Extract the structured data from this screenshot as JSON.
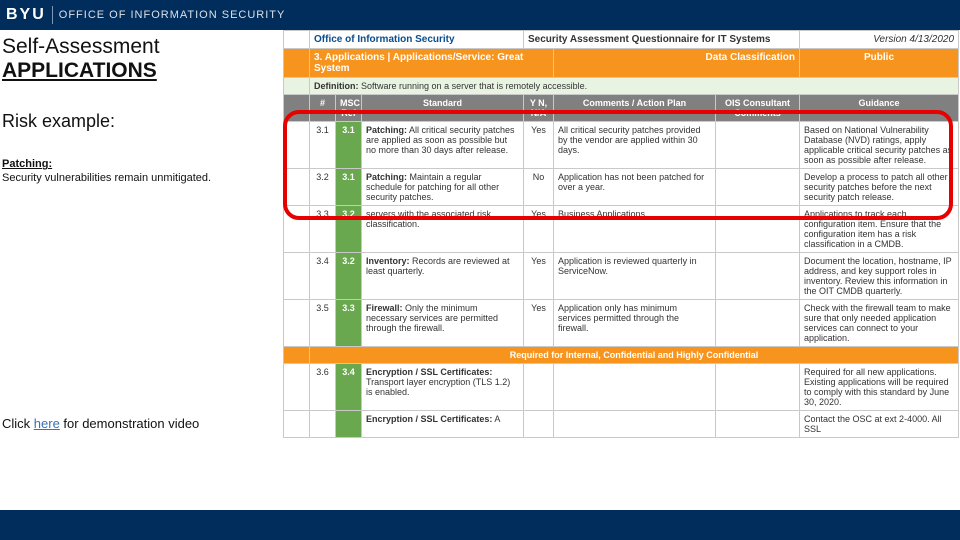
{
  "banner": {
    "logo": "BYU",
    "office": "OFFICE OF INFORMATION SECURITY"
  },
  "left": {
    "title_line1": "Self-Assessment",
    "title_line2": "APPLICATIONS",
    "risk_heading": "Risk example:",
    "patch_label": "Patching:",
    "patch_text": "Security vulnerabilities remain unmitigated.",
    "demo_pre": "Click ",
    "demo_link": "here",
    "demo_post": " for demonstration video"
  },
  "sheet": {
    "top": {
      "office": "Office of Information Security",
      "questionnaire": "Security Assessment Questionnaire for IT Systems",
      "version": "Version 4/13/2020"
    },
    "subheader": {
      "section": "3. Applications  |  Applications/Service: Great System",
      "dc_label": "Data Classification",
      "dc_value": "Public"
    },
    "definition_label": "Definition:",
    "definition_text": "Software running on a server that is remotely accessible.",
    "columns": [
      "#",
      "MSC Ref",
      "Standard",
      "Y N, N/A",
      "Comments / Action Plan",
      "OIS Consultant Comments",
      "Guidance"
    ],
    "rows": [
      {
        "num": "3.1",
        "msc": "3.1",
        "std_label": "Patching:",
        "std_text": "All critical security patches are applied as soon as possible but no more than 30 days after release.",
        "yn": "Yes",
        "comment": "All critical security patches provided by the vendor are applied within 30 days.",
        "guidance": "Based on National Vulnerability Database (NVD) ratings, apply applicable critical security patches as soon as possible after release."
      },
      {
        "num": "3.2",
        "msc": "3.1",
        "std_label": "Patching:",
        "std_text": "Maintain a regular schedule for patching for all other security patches.",
        "yn": "No",
        "comment": "Application has not been patched for over a year.",
        "guidance": "Develop a process to patch all other security patches before the next security patch release."
      },
      {
        "num": "3.3",
        "msc": "3.2",
        "std_label": "",
        "std_text": "servers with the associated risk classification.",
        "yn": "Yes",
        "comment": "Business Applications.",
        "guidance": "Applications to track each configuration item. Ensure that the configuration item has a risk classification in a CMDB."
      },
      {
        "num": "3.4",
        "msc": "3.2",
        "std_label": "Inventory:",
        "std_text": "Records are reviewed at least quarterly.",
        "yn": "Yes",
        "comment": "Application is reviewed quarterly in ServiceNow.",
        "guidance": "Document the location, hostname, IP address, and key support roles in inventory. Review this information in the OIT CMDB quarterly."
      },
      {
        "num": "3.5",
        "msc": "3.3",
        "std_label": "Firewall:",
        "std_text": "Only the minimum necessary services are permitted through the firewall.",
        "yn": "Yes",
        "comment": "Application only has minimum services permitted through the firewall.",
        "guidance": "Check with the firewall team to make sure that only needed application services can connect to your application."
      }
    ],
    "orange_bar": "Required for Internal, Confidential and Highly Confidential",
    "rows2": [
      {
        "num": "3.6",
        "msc": "3.4",
        "std_label": "Encryption / SSL Certificates:",
        "std_text": "Transport layer encryption (TLS 1.2) is enabled.",
        "yn": "",
        "comment": "",
        "guidance": "Required for all new applications. Existing applications will be required to comply with this standard by June 30, 2020."
      },
      {
        "num": "",
        "msc": "",
        "std_label": "Encryption / SSL Certificates:",
        "std_text": "A",
        "yn": "",
        "comment": "",
        "guidance": "Contact the OSC at ext 2-4000.  All SSL"
      }
    ]
  }
}
